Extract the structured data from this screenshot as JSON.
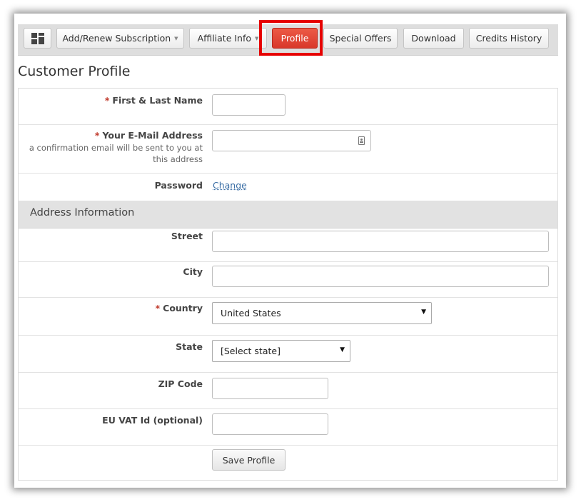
{
  "nav": {
    "items": [
      {
        "label": "",
        "icon": "dashboard-grid-icon"
      },
      {
        "label": "Add/Renew Subscription",
        "caret": "▼"
      },
      {
        "label": "Affiliate Info",
        "caret": "▼"
      },
      {
        "label": "Profile",
        "active": true
      },
      {
        "label": "Special Offers"
      },
      {
        "label": "Download"
      },
      {
        "label": "Credits History"
      }
    ]
  },
  "page": {
    "title": "Customer Profile"
  },
  "form": {
    "name_label": "First & Last Name",
    "name_value": "",
    "email_label": "Your E-Mail Address",
    "email_note": "a confirmation email will be sent to you at this address",
    "email_value": "",
    "password_label": "Password",
    "password_link": "Change",
    "required_mark": "*"
  },
  "address": {
    "section_title": "Address Information",
    "street_label": "Street",
    "city_label": "City",
    "country_label": "Country",
    "country_value": "United States",
    "state_label": "State",
    "state_value": "[Select state]",
    "zip_label": "ZIP Code",
    "vat_label": "EU VAT Id (optional)",
    "select_arrow": "▼"
  },
  "actions": {
    "save_label": "Save Profile"
  },
  "colors": {
    "active_tab": "#e04a39",
    "highlight_box": "#e60000",
    "link": "#3a6ea5"
  }
}
